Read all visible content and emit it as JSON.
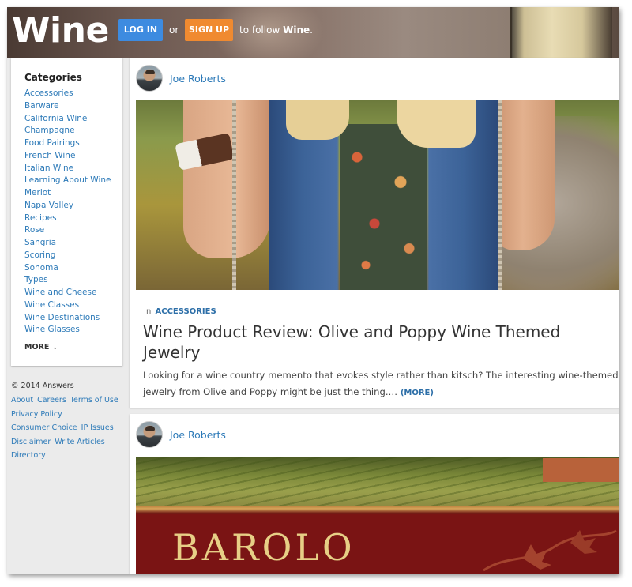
{
  "header": {
    "site_title": "Wine",
    "login_label": "LOG IN",
    "or_text": "or",
    "signup_label": "SIGN UP",
    "follow_prefix": "to follow",
    "follow_target": "Wine",
    "follow_suffix": "."
  },
  "sidebar": {
    "categories_title": "Categories",
    "categories": [
      "Accessories",
      "Barware",
      "California Wine",
      "Champagne",
      "Food Pairings",
      "French Wine",
      "Italian Wine",
      "Learning About Wine",
      "Merlot",
      "Napa Valley",
      "Recipes",
      "Rose",
      "Sangria",
      "Scoring",
      "Sonoma",
      "Types",
      "Wine and Cheese",
      "Wine Classes",
      "Wine Destinations",
      "Wine Glasses"
    ],
    "more_label": "MORE",
    "more_icon": "chevron-down-icon"
  },
  "footer": {
    "copyright": "© 2014 Answers",
    "links": [
      "About",
      "Careers",
      "Terms of Use",
      "Privacy Policy",
      "Consumer Choice",
      "IP Issues",
      "Disclaimer",
      "Write Articles",
      "Directory"
    ]
  },
  "posts": [
    {
      "author": "Joe Roberts",
      "category_prefix": "In",
      "category": "ACCESSORIES",
      "title": "Wine Product Review: Olive and Poppy Wine Themed Jewelry",
      "excerpt": "Looking for a wine country memento that evokes style rather than kitsch? The interesting wine-themed jewelry from Olive and Poppy might be just the thing.…",
      "more_label": "(MORE)"
    },
    {
      "author": "Joe Roberts",
      "image_text": "BAROLO"
    }
  ],
  "colors": {
    "link": "#2d7ab8",
    "login_button": "#3d8be0",
    "signup_button": "#f08a30",
    "page_background": "#ebebeb"
  }
}
